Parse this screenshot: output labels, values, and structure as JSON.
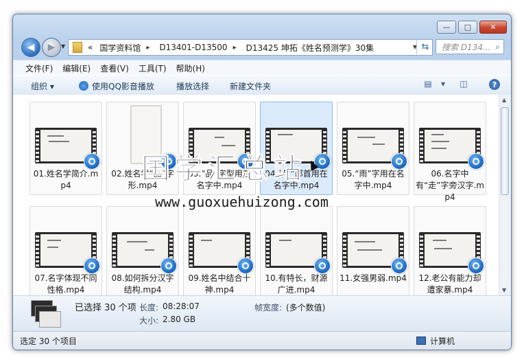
{
  "window": {
    "caption_min": "—",
    "caption_max": "□",
    "caption_close": "✕"
  },
  "address": {
    "overflow": "«",
    "segments": [
      "国学资料馆",
      "D13401-D13500",
      "D13425 坤拓《姓名预测学》30集"
    ],
    "separator": "▸",
    "search_placeholder": "搜索 D134..."
  },
  "menu": [
    "文件(F)",
    "编辑(E)",
    "查看(V)",
    "工具(T)",
    "帮助(H)"
  ],
  "toolbar": {
    "organize": "组织 ▾",
    "play_qq": "使用QQ影音播放",
    "play_select": "播放选择",
    "new_folder": "新建文件夹",
    "help": "?"
  },
  "files": [
    {
      "label": "01.姓名学简介.mp4",
      "selected": false
    },
    {
      "label": "02.姓名学“品”字形.mp4",
      "selected": false
    },
    {
      "label": "03.“品”字型用在名字中.mp4",
      "selected": false
    },
    {
      "label": "04.带“”部首用在名字中.mp4",
      "selected": true
    },
    {
      "label": "05.“雨”字用在名字中.mp4",
      "selected": false
    },
    {
      "label": "06.名字中有“走”字旁汉字.mp4",
      "selected": false
    },
    {
      "label": "07.名字体现不同性格.mp4",
      "selected": false
    },
    {
      "label": "08.如何拆分汉字结构.mp4",
      "selected": false
    },
    {
      "label": "09.姓名中结合十神.mp4",
      "selected": false
    },
    {
      "label": "10.有特长，财源广进.mp4",
      "selected": false
    },
    {
      "label": "11.女强男弱.mp4",
      "selected": false
    },
    {
      "label": "12.老公有能力却遭家暴.mp4",
      "selected": false
    }
  ],
  "details": {
    "selected_text": "已选择 30 个项",
    "length_label": "长度:",
    "length_value": "08:28:07",
    "size_label": "大小:",
    "size_value": "2.80 GB",
    "width_label": "帧宽度:",
    "width_value": "(多个数值)"
  },
  "status": {
    "left": "选定 30 个项目",
    "right": "计算机"
  },
  "watermark": {
    "cn": "国学汇总站",
    "url": "www.guoxuehuizong.com"
  }
}
